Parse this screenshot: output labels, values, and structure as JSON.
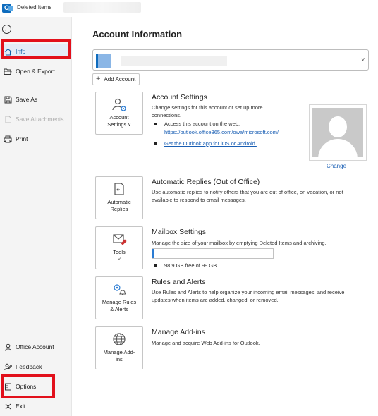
{
  "window": {
    "title": "Deleted Items"
  },
  "sidebar": {
    "items": [
      {
        "label": "Info",
        "active": true
      },
      {
        "label": "Open & Export"
      },
      {
        "label": "Save As"
      },
      {
        "label": "Save Attachments",
        "disabled": true
      },
      {
        "label": "Print"
      }
    ],
    "bottom_items": [
      {
        "label": "Office Account"
      },
      {
        "label": "Feedback"
      },
      {
        "label": "Options"
      },
      {
        "label": "Exit"
      }
    ]
  },
  "main": {
    "page_title": "Account Information",
    "add_account_label": "Add Account",
    "sections": {
      "account_settings": {
        "tile_label": "Account\nSettings ˅",
        "title": "Account Settings",
        "description": "Change settings for this account or set up more connections.",
        "bullet1": "Access this account on the web.",
        "bullet1_link": "https://outlook.office365.com/owa/microsoft.com/",
        "bullet2_link": "Get the Outlook app for iOS or Android.",
        "change_label": "Change"
      },
      "automatic_replies": {
        "tile_label": "Automatic\nReplies",
        "title": "Automatic Replies (Out of Office)",
        "description": "Use automatic replies to notify others that you are out of office, on vacation, or not available to respond to email messages."
      },
      "mailbox_settings": {
        "tile_label": "Tools\n˅",
        "title": "Mailbox Settings",
        "description": "Manage the size of your mailbox by emptying Deleted Items and archiving.",
        "storage_text": "98.9 GB free of 99 GB",
        "used_fraction": 0.011
      },
      "rules_alerts": {
        "tile_label": "Manage Rules\n& Alerts",
        "title": "Rules and Alerts",
        "description": "Use Rules and Alerts to help organize your incoming email messages, and receive updates when items are added, changed, or removed."
      },
      "addins": {
        "tile_label": "Manage Add-\nins",
        "title": "Manage Add-ins",
        "description": "Manage and acquire Web Add-ins for Outlook."
      }
    }
  },
  "colors": {
    "highlight": "#e2101b",
    "accent": "#0f6cbd",
    "link": "#1a5fb4"
  }
}
